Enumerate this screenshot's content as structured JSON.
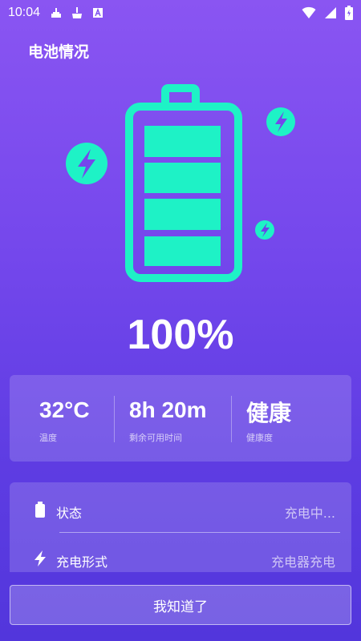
{
  "status_bar": {
    "time": "10:04",
    "left_icons": [
      "cleaner-icon",
      "broom-icon",
      "font-icon"
    ],
    "right_icons": [
      "wifi-icon",
      "signal-icon",
      "battery-icon"
    ]
  },
  "page": {
    "title": "电池情况"
  },
  "battery": {
    "level_percent": 100,
    "percent_label": "100%",
    "accent_color": "#1EF2C6",
    "icon": "battery-full-icon",
    "decor_icons": [
      "bolt-icon-large",
      "bolt-icon-medium",
      "bolt-icon-small"
    ]
  },
  "stats": [
    {
      "value": "32°C",
      "label": "温度"
    },
    {
      "value": "8h 20m",
      "label": "剩余可用时间"
    },
    {
      "value": "健康",
      "label": "健康度"
    }
  ],
  "info": [
    {
      "icon": "battery-small-icon",
      "label": "状态",
      "value": "充电中..."
    },
    {
      "icon": "bolt-icon",
      "label": "充电形式",
      "value": "充电器充电"
    }
  ],
  "actions": {
    "confirm_label": "我知道了"
  }
}
